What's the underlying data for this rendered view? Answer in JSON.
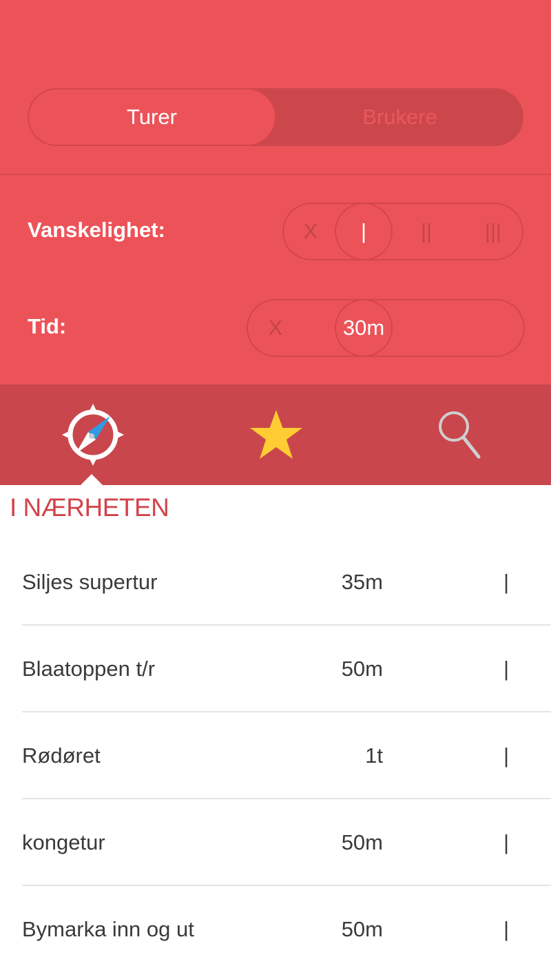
{
  "colors": {
    "primary": "#ec5359",
    "primary_dark": "#c9474c",
    "accent_star": "#ffcc33",
    "compass_needle": "#2f9ae3"
  },
  "segment": {
    "tabs": [
      "Turer",
      "Brukere"
    ],
    "selected": "Turer"
  },
  "filters": {
    "difficulty": {
      "label": "Vanskelighet:",
      "options": [
        "X",
        "|",
        "||",
        "|||"
      ],
      "selected": "|"
    },
    "time": {
      "label": "Tid:",
      "options": [
        "X",
        "30m"
      ],
      "selected": "30m"
    }
  },
  "tabbar": {
    "items": [
      {
        "icon": "compass-icon",
        "selected": true
      },
      {
        "icon": "star-icon",
        "selected": false
      },
      {
        "icon": "search-icon",
        "selected": false
      }
    ]
  },
  "section": {
    "title": "I NÆRHETEN"
  },
  "trips": [
    {
      "name": "Siljes supertur",
      "duration": "35m",
      "difficulty": "|"
    },
    {
      "name": "Blaatoppen t/r",
      "duration": "50m",
      "difficulty": "|"
    },
    {
      "name": "Rødøret",
      "duration": "1t",
      "difficulty": "|"
    },
    {
      "name": "kongetur",
      "duration": "50m",
      "difficulty": "|"
    },
    {
      "name": "Bymarka inn og ut",
      "duration": "50m",
      "difficulty": "|"
    }
  ]
}
